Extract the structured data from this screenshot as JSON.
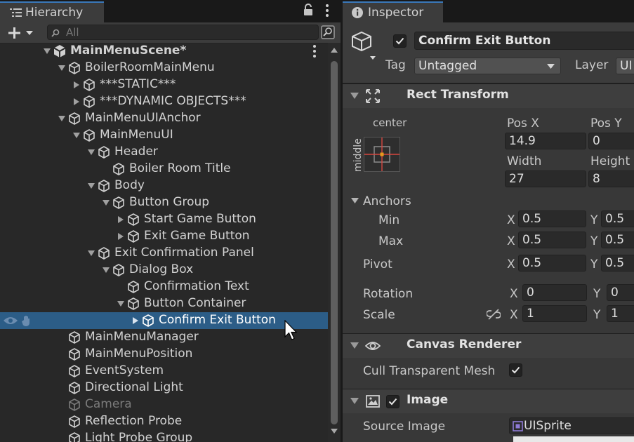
{
  "hierarchy": {
    "tab_title": "Hierarchy",
    "search_placeholder": "All",
    "tree": [
      {
        "label": "MainMenuScene*",
        "depth": 0,
        "fold": "open",
        "kind": "scene"
      },
      {
        "label": "BoilerRoomMainMenu",
        "depth": 1,
        "fold": "open",
        "kind": "go"
      },
      {
        "label": "***STATIC***",
        "depth": 2,
        "fold": "closed",
        "kind": "go"
      },
      {
        "label": "***DYNAMIC OBJECTS***",
        "depth": 2,
        "fold": "closed",
        "kind": "go"
      },
      {
        "label": "MainMenuUIAnchor",
        "depth": 1,
        "fold": "open",
        "kind": "go"
      },
      {
        "label": "MainMenuUI",
        "depth": 2,
        "fold": "open",
        "kind": "go"
      },
      {
        "label": "Header",
        "depth": 3,
        "fold": "open",
        "kind": "go"
      },
      {
        "label": "Boiler Room Title",
        "depth": 4,
        "fold": "none",
        "kind": "go"
      },
      {
        "label": "Body",
        "depth": 3,
        "fold": "open",
        "kind": "go"
      },
      {
        "label": "Button Group",
        "depth": 4,
        "fold": "open",
        "kind": "go"
      },
      {
        "label": "Start Game Button",
        "depth": 5,
        "fold": "closed",
        "kind": "go"
      },
      {
        "label": "Exit Game Button",
        "depth": 5,
        "fold": "closed",
        "kind": "go"
      },
      {
        "label": "Exit Confirmation Panel",
        "depth": 3,
        "fold": "open",
        "kind": "go"
      },
      {
        "label": "Dialog Box",
        "depth": 4,
        "fold": "open",
        "kind": "go"
      },
      {
        "label": "Confirmation Text",
        "depth": 5,
        "fold": "none",
        "kind": "go"
      },
      {
        "label": "Button Container",
        "depth": 5,
        "fold": "open",
        "kind": "go"
      },
      {
        "label": "Confirm Exit Button",
        "depth": 6,
        "fold": "closed",
        "kind": "go",
        "selected": true
      },
      {
        "label": "MainMenuManager",
        "depth": 1,
        "fold": "none",
        "kind": "go"
      },
      {
        "label": "MainMenuPosition",
        "depth": 1,
        "fold": "none",
        "kind": "go"
      },
      {
        "label": "EventSystem",
        "depth": 1,
        "fold": "none",
        "kind": "go"
      },
      {
        "label": "Directional Light",
        "depth": 1,
        "fold": "none",
        "kind": "go"
      },
      {
        "label": "Camera",
        "depth": 1,
        "fold": "none",
        "kind": "go",
        "disabled": true
      },
      {
        "label": "Reflection Probe",
        "depth": 1,
        "fold": "none",
        "kind": "go"
      },
      {
        "label": "Light Probe Group",
        "depth": 1,
        "fold": "none",
        "kind": "go"
      }
    ]
  },
  "inspector": {
    "tab_title": "Inspector",
    "object_name": "Confirm Exit Button",
    "active": true,
    "tag_label": "Tag",
    "tag_value": "Untagged",
    "layer_label": "Layer",
    "layer_value": "UI",
    "rect_transform": {
      "title": "Rect Transform",
      "anchor_preset_h": "center",
      "anchor_preset_v": "middle",
      "pos_x_label": "Pos X",
      "pos_x": "14.9",
      "pos_y_label": "Pos Y",
      "pos_y": "0",
      "width_label": "Width",
      "width": "27",
      "height_label": "Height",
      "height": "8",
      "anchors_label": "Anchors",
      "min_label": "Min",
      "min_x": "0.5",
      "min_y": "0.5",
      "max_label": "Max",
      "max_x": "0.5",
      "max_y": "0.5",
      "pivot_label": "Pivot",
      "pivot_x": "0.5",
      "pivot_y": "0.5",
      "rotation_label": "Rotation",
      "rot_x": "0",
      "rot_y": "0",
      "scale_label": "Scale",
      "scale_x": "1",
      "scale_y": "1",
      "x_label": "X",
      "y_label": "Y"
    },
    "canvas_renderer": {
      "title": "Canvas Renderer",
      "cull_label": "Cull Transparent Mesh",
      "cull_value": true
    },
    "image": {
      "title": "Image",
      "enabled": true,
      "source_label": "Source Image",
      "source_value": "UISprite"
    }
  },
  "colors": {
    "selection": "#2c5d87",
    "tab_accent": "#3a79bb",
    "anchor_red": "#d7473f",
    "anchor_orange": "#e59a1c"
  }
}
